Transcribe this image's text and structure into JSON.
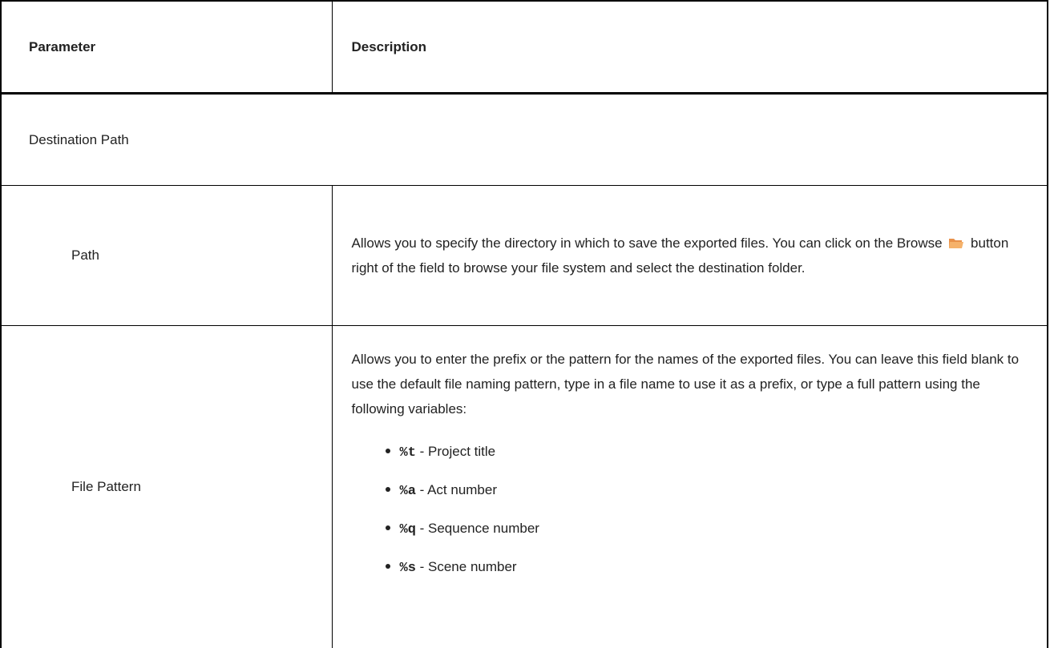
{
  "table": {
    "header": {
      "parameter": "Parameter",
      "description": "Description"
    },
    "section_title": "Destination Path",
    "rows": [
      {
        "parameter": "Path",
        "desc_before": "Allows you to specify the directory in which to save the exported files. You can click on the Browse",
        "desc_icon": "folder-icon",
        "desc_after": "button right of the field to browse your file system and select the destination folder."
      },
      {
        "parameter": "File Pattern",
        "desc": "Allows you to enter the prefix or the pattern for the names of the exported files. You can leave this field blank to use the default file naming pattern, type in a file name to use it as a prefix, or type a full pattern using the following variables:",
        "variables": [
          {
            "code": "%t",
            "text": " - Project title"
          },
          {
            "code": "%a",
            "text": " - Act number"
          },
          {
            "code": "%q",
            "text": " - Sequence number"
          },
          {
            "code": "%s",
            "text": " - Scene number"
          }
        ]
      }
    ]
  },
  "colors": {
    "border": "#000000",
    "folder_fill": "#F5B26B",
    "folder_dark": "#E8914A"
  }
}
